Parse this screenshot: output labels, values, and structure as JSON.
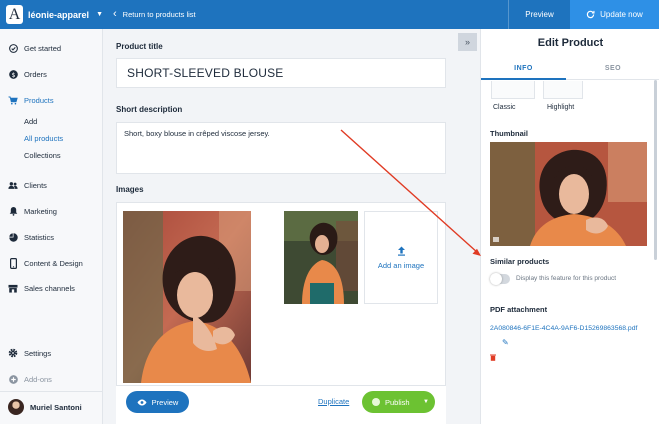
{
  "topbar": {
    "store_name": "léonie-apparel",
    "back_label": "Return to products list",
    "preview_label": "Preview",
    "update_label": "Update now"
  },
  "sidebar": {
    "items": [
      {
        "label": "Get started",
        "icon": "check-circle-icon"
      },
      {
        "label": "Orders",
        "icon": "dollar-circle-icon"
      },
      {
        "label": "Products",
        "icon": "cart-icon",
        "active": true
      },
      {
        "label": "Clients",
        "icon": "people-icon"
      },
      {
        "label": "Marketing",
        "icon": "bell-icon"
      },
      {
        "label": "Statistics",
        "icon": "pie-chart-icon"
      },
      {
        "label": "Content & Design",
        "icon": "phone-icon"
      },
      {
        "label": "Sales channels",
        "icon": "store-icon"
      }
    ],
    "subitems": [
      {
        "label": "Add"
      },
      {
        "label": "All products",
        "active": true
      },
      {
        "label": "Collections"
      }
    ],
    "settings_label": "Settings",
    "addons_label": "Add-ons",
    "user_name": "Muriel Santoni"
  },
  "main": {
    "title_label": "Product title",
    "title_value": "SHORT-SLEEVED BLOUSE",
    "description_label": "Short description",
    "description_value": "Short, boxy blouse in crêped viscose jersey.",
    "images_label": "Images",
    "add_image_label": "Add an image",
    "preview_button": "Preview",
    "duplicate_link": "Duplicate",
    "publish_button": "Publish"
  },
  "panel": {
    "title": "Edit Product",
    "tabs": [
      "INFO",
      "SEO"
    ],
    "template_classic": "Classic",
    "template_highlight": "Highlight",
    "thumbnail_label": "Thumbnail",
    "similar_label": "Similar products",
    "similar_toggle_text": "Display this feature for this product",
    "similar_enabled": false,
    "pdf_label": "PDF attachment",
    "pdf_filename": "2A080846-6F1E-4C4A-9AF6-D15269863568.pdf"
  },
  "colors": {
    "brand_blue": "#1e73be",
    "publish_green": "#6cc232",
    "annotation_red": "#e03b24"
  }
}
